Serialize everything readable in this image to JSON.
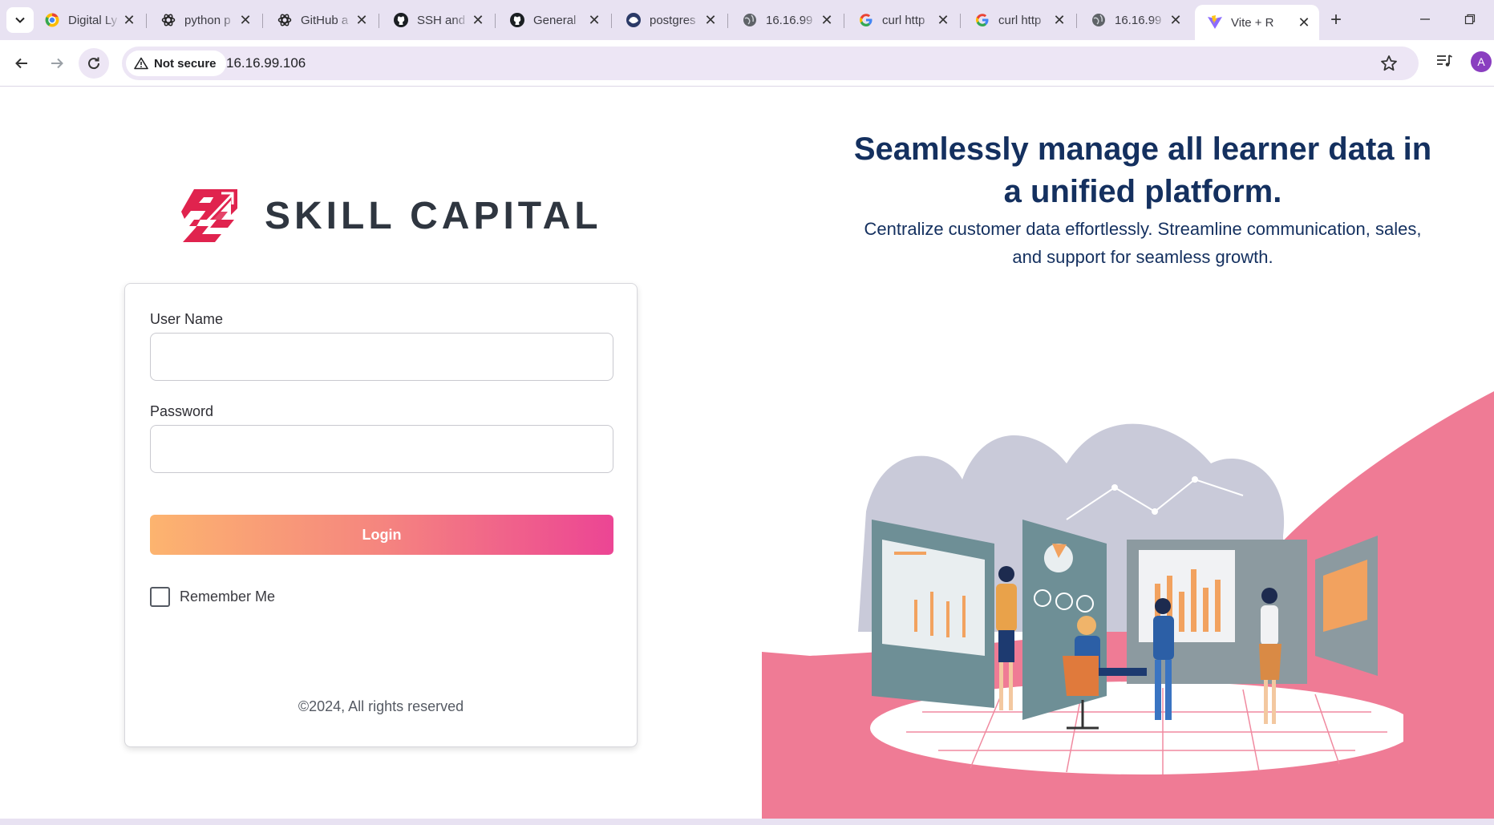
{
  "browser": {
    "tabs": [
      {
        "title": "Digital Ly",
        "icon": "chrome-web-store-icon"
      },
      {
        "title": "python p",
        "icon": "chatgpt-icon"
      },
      {
        "title": "GitHub a",
        "icon": "chatgpt-icon"
      },
      {
        "title": "SSH and",
        "icon": "github-icon"
      },
      {
        "title": "General",
        "icon": "github-icon"
      },
      {
        "title": "postgres",
        "icon": "docker-icon"
      },
      {
        "title": "16.16.99",
        "icon": "globe-icon"
      },
      {
        "title": "curl http",
        "icon": "google-icon"
      },
      {
        "title": "curl http",
        "icon": "google-icon"
      },
      {
        "title": "16.16.99",
        "icon": "globe-icon"
      },
      {
        "title": "Vite + R",
        "icon": "vite-icon",
        "active": true
      }
    ],
    "new_tab": "+",
    "security_chip": "Not secure",
    "url": "16.16.99.106",
    "avatar_initial": "A",
    "tab_close_glyph": "✕"
  },
  "brand": {
    "name": "SKILL CAPITAL",
    "logo_color": "#e0234e"
  },
  "login": {
    "username_label": "User Name",
    "username_value": "",
    "password_label": "Password",
    "password_value": "",
    "login_button": "Login",
    "remember_label": "Remember Me",
    "remember_checked": false,
    "copyright": "©2024, All rights reserved"
  },
  "hero": {
    "headline": "Seamlessly manage all learner data in a unified platform.",
    "subline": "Centralize customer data effortlessly. Streamline communication, sales, and support for seamless growth."
  },
  "colors": {
    "accent_pink": "#ef7b95",
    "headline_navy": "#14305f",
    "gradient_start": "#fcb46f",
    "gradient_end": "#ec4594"
  }
}
